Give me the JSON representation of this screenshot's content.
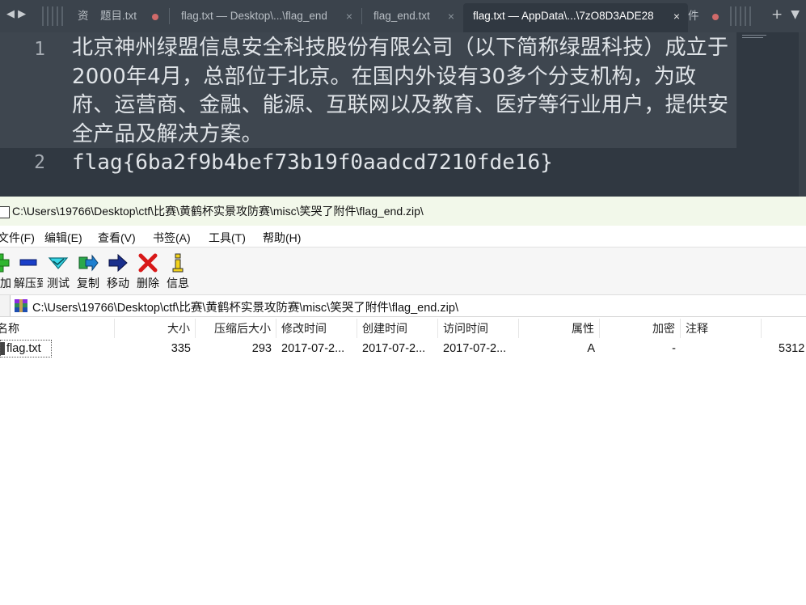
{
  "editor": {
    "tabs": [
      {
        "label": "资"
      },
      {
        "label": "题目.txt",
        "dirty": true
      },
      {
        "label": "flag.txt — Desktop\\...\\flag_end",
        "close": "×"
      },
      {
        "label": "flag_end.txt",
        "close": "×"
      },
      {
        "label": "flag.txt — AppData\\...\\7zO8D3ADE28",
        "close": "×",
        "active": true
      },
      {
        "label": "件",
        "dirty": true
      }
    ],
    "nav_left": "◀ ▶",
    "tools": {
      "add": "+",
      "menu": "▼"
    },
    "lines": [
      {
        "number": "1",
        "text": "北京神州绿盟信息安全科技股份有限公司（以下简称绿盟科技）成立于2000年4月，总部位于北京。在国内外设有30多个分支机构，为政府、运营商、金融、能源、互联网以及教育、医疗等行业用户，提供安全产品及解决方案。"
      },
      {
        "number": "2",
        "text": "flag{6ba2f9b4bef73b19f0aadcd7210fde16}"
      }
    ],
    "colors": {
      "background": "#303841",
      "text": "#e0e4e8",
      "current_line": "#3e464f"
    }
  },
  "rar": {
    "title": "C:\\Users\\19766\\Desktop\\ctf\\比赛\\黄鹤杯实景攻防赛\\misc\\笑哭了附件\\flag_end.zip\\",
    "menu": [
      "文件(F)",
      "编辑(E)",
      "查看(V)",
      "书签(A)",
      "工具(T)",
      "帮助(H)"
    ],
    "toolbar": [
      "添加",
      "解压到",
      "测试",
      "复制",
      "移动",
      "删除",
      "信息"
    ],
    "path": "C:\\Users\\19766\\Desktop\\ctf\\比赛\\黄鹤杯实景攻防赛\\misc\\笑哭了附件\\flag_end.zip\\",
    "columns": [
      "名称",
      "大小",
      "压缩后大小",
      "修改时间",
      "创建时间",
      "访问时间",
      "属性",
      "加密",
      "注释"
    ],
    "rows": [
      {
        "name": "flag.txt",
        "size": "335",
        "packed": "293",
        "modified": "2017-07-2...",
        "created": "2017-07-2...",
        "accessed": "2017-07-2...",
        "attr": "A",
        "encrypted": "-",
        "comment": "",
        "crc": "5312"
      }
    ]
  }
}
